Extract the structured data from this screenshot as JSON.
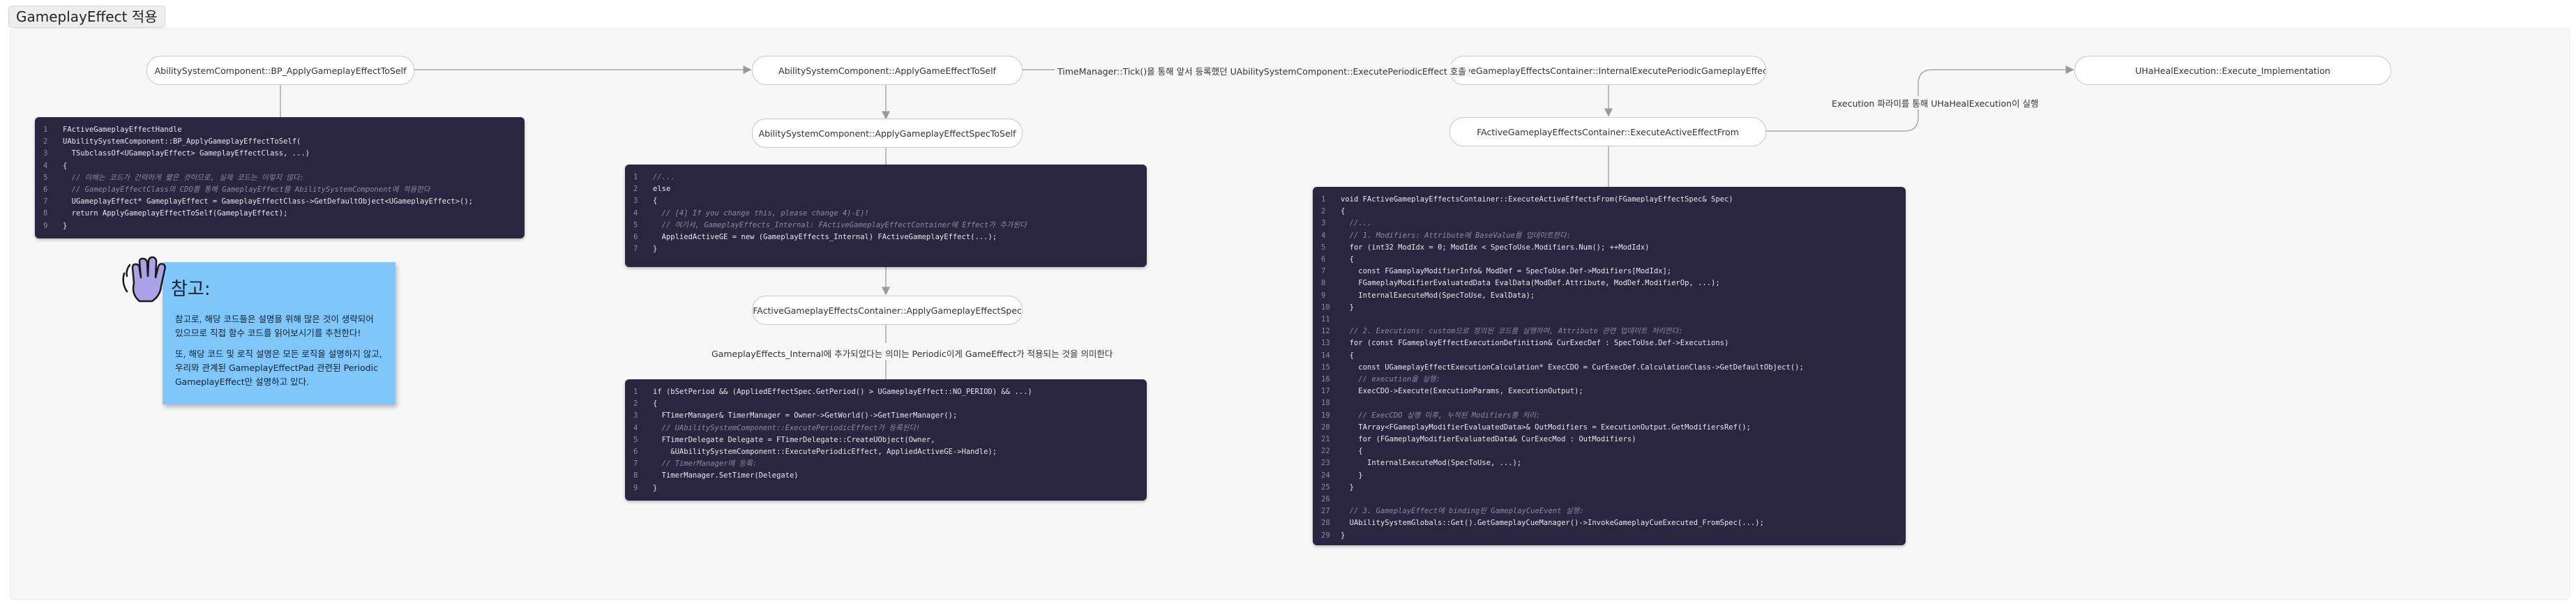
{
  "frame": {
    "title": "GameplayEffect 적용"
  },
  "nodes": {
    "bp_apply": "AbilitySystemComponent::BP_ApplyGameplayEffectToSelf",
    "apply_to_self": "AbilitySystemComponent::ApplyGameEffectToSelf",
    "apply_spec_to_self": "AbilitySystemComponent::ApplyGameplayEffectSpecToSelf",
    "container_apply": "FActiveGameplayEffectsContainer::ApplyGameplayEffectSpec",
    "internal_periodic": "FActiveGameplayEffectsContainer::InternalExecutePeriodicGameplayEffect",
    "execute_active": "FActiveGameplayEffectsContainer::ExecuteActiveEffectFrom",
    "uhealexec": "UHaHealExecution::Execute_Implementation"
  },
  "edge_labels": {
    "timer_tick": "TimeManager::Tick()을 통해 앞서 등록했던 UAbilitySystemComponent::ExecutePeriodicEffect 호출",
    "execution_class": "Execution 파라미를 통해 UHaHealExecution이 실행",
    "periodic_note": "GameplayEffects_Internal에 추가되었다는 의미는 Periodic이게 GameEffect가 적용되는 것을 의미한다"
  },
  "note": {
    "title": "참고:",
    "p1": "참고로, 해당 코드들은 설명을 위해 많은 것이 생략되어 있으므로 직접 함수 코드를 읽어보시기를 추천한다!",
    "p2": "또, 해당 코드 및 로직 설명은 모든 로직을 설명하지 않고, 우리와 관계된 GameplayEffectPad 관련된 Periodic GameplayEffect만 설명하고 있다."
  },
  "code_blocks": {
    "bp_code": [
      "FActiveGameplayEffectHandle",
      "UAbilitySystemComponent::BP_ApplyGameplayEffectToSelf(",
      "  TSubclassOf<UGameplayEffect> GameplayEffectClass, ...)",
      "{",
      "  // 이해는 코드가 간략하게 짧은 것이므로, 실제 코드는 이렇지 않다:",
      "  // GameplayEffectClass의 CDO를 통해 GameplayEffect를 AbilitySystemComponent에 적용한다",
      "  UGameplayEffect* GameplayEffect = GameplayEffectClass->GetDefaultObject<UGameplayEffect>();",
      "  return ApplyGameplayEffectToSelf(GameplayEffect);",
      "}"
    ],
    "spec_code": [
      "//...",
      "else",
      "{",
      "  // [4] If you change this, please change 4)-E)!",
      "  // 여기서, GameplayEffects_Internal: FActiveGameplayEffectContainer에 Effect가 추가된다",
      "  AppliedActiveGE = new (GameplayEffects_Internal) FActiveGameplayEffect(...);",
      "}"
    ],
    "periodic_code": [
      "if (bSetPeriod && (AppliedEffectSpec.GetPeriod() > UGameplayEffect::NO_PERIOD) && ...)",
      "{",
      "  FTimerManager& TimerManager = Owner->GetWorld()->GetTimerManager();",
      "  // UAbilitySystemComponent::ExecutePeriodicEffect가 등록된다!",
      "  FTimerDelegate Delegate = FTimerDelegate::CreateUObject(Owner,",
      "    &UAbilitySystemComponent::ExecutePeriodicEffect, AppliedActiveGE->Handle);",
      "  // TimerManager에 등록:",
      "  TimerManager.SetTimer(Delegate)",
      "}"
    ],
    "execute_code": [
      "void FActiveGameplayEffectsContainer::ExecuteActiveEffectsFrom(FGameplayEffectSpec& Spec)",
      "{",
      "  //...",
      "  // 1. Modifiers: Attribute에 BaseValue를 업데이트한다:",
      "  for (int32 ModIdx = 0; ModIdx < SpecToUse.Modifiers.Num(); ++ModIdx)",
      "  {",
      "    const FGameplayModifierInfo& ModDef = SpecToUse.Def->Modifiers[ModIdx];",
      "    FGameplayModifierEvaluatedData EvalData(ModDef.Attribute, ModDef.ModifierOp, ...);",
      "    InternalExecuteMod(SpecToUse, EvalData);",
      "  }",
      "",
      "  // 2. Executions: custom으로 정의된 코드를 실행하여, Attribute 관련 업데이트 처리한다:",
      "  for (const FGameplayEffectExecutionDefinition& CurExecDef : SpecToUse.Def->Executions)",
      "  {",
      "    const UGameplayEffectExecutionCalculation* ExecCDO = CurExecDef.CalculationClass->GetDefaultObject();",
      "    // execution을 실행:",
      "    ExecCDO->Execute(ExecutionParams, ExecutionOutput);",
      "",
      "    // ExecCDO 실행 이후, 누적된 Modifiers를 처리:",
      "    TArray<FGameplayModifierEvaluatedData>& OutModifiers = ExecutionOutput.GetModifiersRef();",
      "    for (FGameplayModifierEvaluatedData& CurExecMod : OutModifiers)",
      "    {",
      "      InternalExecuteMod(SpecToUse, ...);",
      "    }",
      "  }",
      "",
      "  // 3. GameplayEffect에 binding된 GameplayCueEvent 실행:",
      "  UAbilitySystemGlobals::Get().GetGameplayCueManager()->InvokeGameplayCueExecuted_FromSpec(...);",
      "}"
    ]
  },
  "colors": {
    "code_bg": "#2a2640",
    "note_bg": "#7fc6f9",
    "code_func": "#4fb7e3",
    "code_comment": "#8c88a8"
  }
}
